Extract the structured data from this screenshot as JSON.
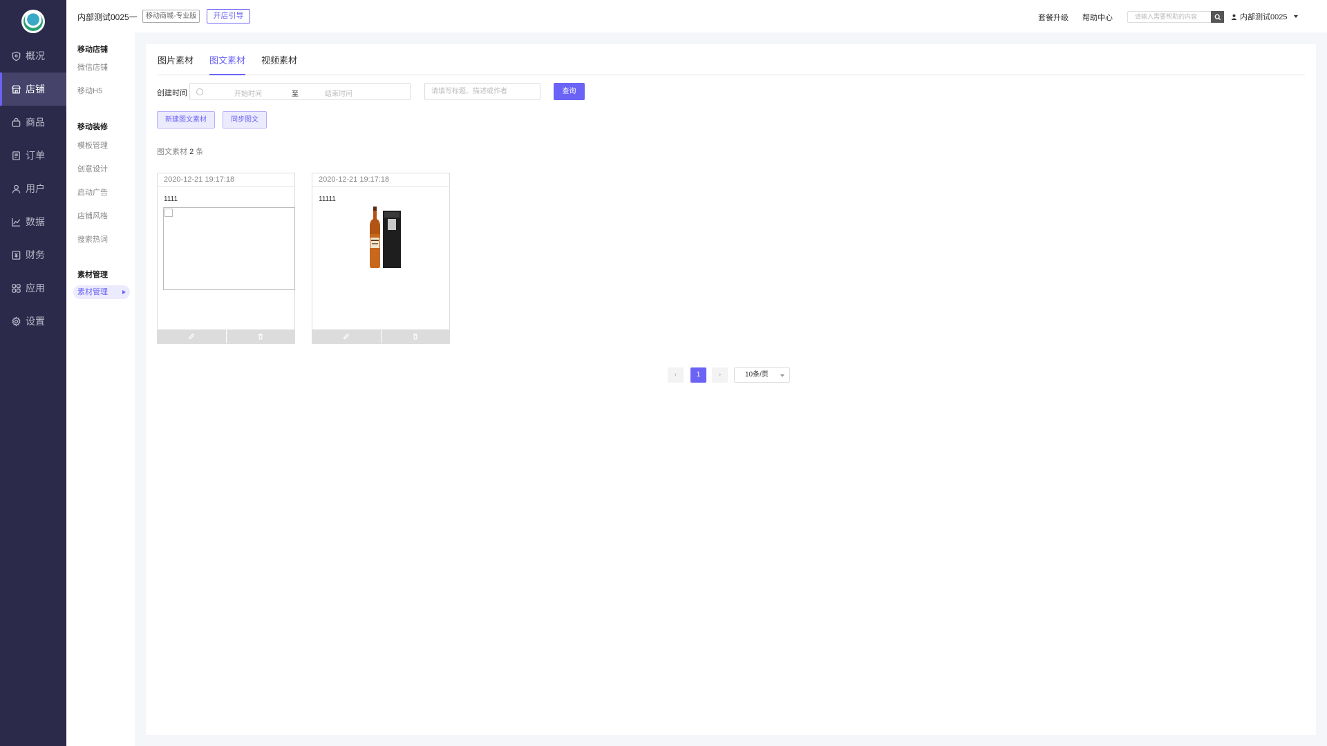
{
  "colors": {
    "accent": "#6b63f6",
    "sidebar_bg": "#2c2a4a"
  },
  "main_nav": [
    {
      "label": "概况",
      "icon": "shield-icon"
    },
    {
      "label": "店铺",
      "icon": "store-icon",
      "active": true
    },
    {
      "label": "商品",
      "icon": "bag-icon"
    },
    {
      "label": "订单",
      "icon": "order-icon"
    },
    {
      "label": "用户",
      "icon": "user-icon"
    },
    {
      "label": "数据",
      "icon": "chart-icon"
    },
    {
      "label": "财务",
      "icon": "finance-icon"
    },
    {
      "label": "应用",
      "icon": "apps-icon"
    },
    {
      "label": "设置",
      "icon": "gear-icon"
    }
  ],
  "sub_nav": {
    "groups": [
      {
        "title": "移动店铺",
        "items": [
          "微信店铺",
          "移动H5"
        ]
      },
      {
        "title": "移动装修",
        "items": [
          "模板管理",
          "创意设计",
          "启动广告",
          "店铺风格",
          "搜索热词"
        ]
      },
      {
        "title": "素材管理",
        "items": [
          "素材管理"
        ]
      }
    ]
  },
  "topbar": {
    "store_name": "内部测试0025一",
    "edition": "移动商城-专业版",
    "guide_button": "开店引导",
    "upgrade": "套餐升级",
    "help": "帮助中心",
    "search_placeholder": "请输入需要帮助的内容",
    "user": "内部测试0025"
  },
  "tabs": [
    "图片素材",
    "图文素材",
    "视频素材"
  ],
  "active_tab": "图文素材",
  "filter": {
    "label": "创建时间",
    "start_placeholder": "开始时间",
    "separator": "至",
    "end_placeholder": "结束时间",
    "keyword_placeholder": "请填写标题、描述或作者",
    "query_button": "查询"
  },
  "actions": {
    "new_button": "新建图文素材",
    "sync_button": "同步图文"
  },
  "summary": {
    "prefix": "图文素材",
    "count": "2",
    "suffix": "条"
  },
  "cards": [
    {
      "date": "2020-12-21 19:17:18",
      "title": "1111"
    },
    {
      "date": "2020-12-21 19:17:18",
      "title": "11111"
    }
  ],
  "pagination": {
    "current": "1",
    "page_size": "10条/页"
  }
}
